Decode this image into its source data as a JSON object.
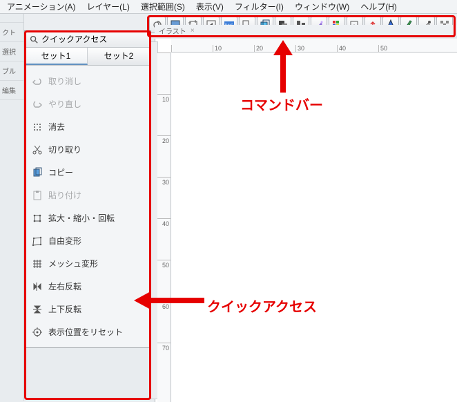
{
  "menubar": {
    "items": [
      "アニメーション(A)",
      "レイヤー(L)",
      "選択範囲(S)",
      "表示(V)",
      "フィルター(I)",
      "ウィンドウ(W)",
      "ヘルプ(H)"
    ]
  },
  "toolbar": {
    "buttons": [
      "spiral-icon",
      "canvas-icon",
      "crop-icon",
      "goback-icon",
      "png-icon",
      "resize-icon",
      "layer-icon",
      "stack-icon",
      "align-icon",
      "wand-icon",
      "palette-icon",
      "open-icon",
      "upload-icon",
      "pen-icon",
      "brush-icon",
      "eyedropper-icon",
      "pixel-icon"
    ]
  },
  "left_trim": {
    "items": [
      "",
      "クト",
      "選択",
      "ブル",
      "編集"
    ]
  },
  "canvas_header": {
    "label": "イラスト"
  },
  "ruler": {
    "h": [
      "",
      "10",
      "20",
      "30",
      "40",
      "50"
    ],
    "v": [
      "",
      "10",
      "20",
      "30",
      "40",
      "50",
      "60",
      "70"
    ]
  },
  "panel": {
    "title": "クイックアクセス",
    "set_tabs": [
      "セット1",
      "セット2"
    ],
    "items": [
      {
        "icon": "undo-icon",
        "label": "取り消し",
        "disabled": true
      },
      {
        "icon": "redo-icon",
        "label": "やり直し",
        "disabled": true
      },
      {
        "icon": "clear-icon",
        "label": "消去",
        "disabled": false
      },
      {
        "icon": "cut-icon",
        "label": "切り取り",
        "disabled": false
      },
      {
        "icon": "copy-icon",
        "label": "コピー",
        "disabled": false
      },
      {
        "icon": "paste-icon",
        "label": "貼り付け",
        "disabled": true
      },
      {
        "icon": "scale-icon",
        "label": "拡大・縮小・回転",
        "disabled": false
      },
      {
        "icon": "freetransform-icon",
        "label": "自由変形",
        "disabled": false
      },
      {
        "icon": "mesh-icon",
        "label": "メッシュ変形",
        "disabled": false
      },
      {
        "icon": "fliph-icon",
        "label": "左右反転",
        "disabled": false
      },
      {
        "icon": "flipv-icon",
        "label": "上下反転",
        "disabled": false
      },
      {
        "icon": "resetview-icon",
        "label": "表示位置をリセット",
        "disabled": false
      }
    ]
  },
  "annotations": {
    "commandbar": "コマンドバー",
    "quickaccess": "クイックアクセス"
  }
}
